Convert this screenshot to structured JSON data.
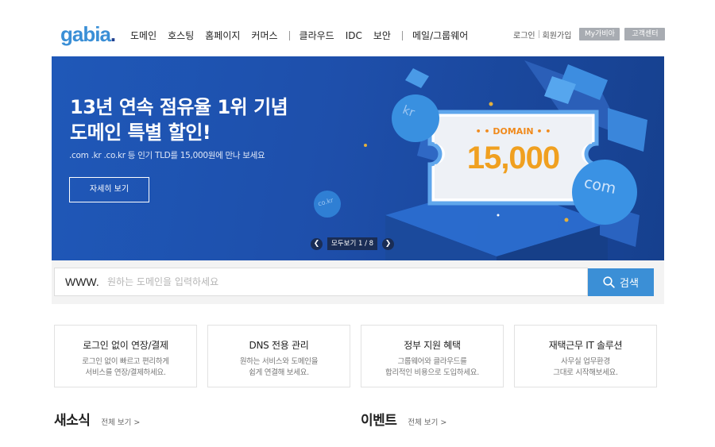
{
  "header": {
    "logo": "gabia",
    "logo_dot": ".",
    "nav_group1": [
      "도메인",
      "호스팅",
      "홈페이지",
      "커머스"
    ],
    "nav_group2": [
      "클라우드",
      "IDC",
      "보안"
    ],
    "nav_group3": [
      "메일/그룹웨어"
    ],
    "login": "로그인",
    "signup": "회원가입",
    "my_gabia": "My가비아",
    "support": "고객센터"
  },
  "banner": {
    "title_line1": "13년 연속 점유율 1위 기념",
    "title_line2": "도메인 특별 할인!",
    "subtitle": ".com .kr .co.kr 등 인기 TLD를 15,000원에 만나 보세요",
    "more_button": "자세히 보기",
    "ticket_label": "DOMAIN",
    "ticket_price": "15,000",
    "bubble_kr": "kr",
    "bubble_com": "com",
    "bubble_cokr": "co.kr",
    "pager_text": "모두보기 1 / 8",
    "colors": {
      "bg": "#1f58b8",
      "price": "#f0a020"
    }
  },
  "search": {
    "prefix": "WWW.",
    "placeholder": "원하는 도메인을 입력하세요",
    "button": "검색"
  },
  "cards": [
    {
      "title": "로그인 없이 연장/결제",
      "desc1": "로그인 없이 빠르고 편리하게",
      "desc2": "서비스를 연장/결제하세요."
    },
    {
      "title": "DNS 전용 관리",
      "desc1": "원하는 서비스와 도메인을",
      "desc2": "쉽게 연결해 보세요."
    },
    {
      "title": "정부 지원 혜택",
      "desc1": "그룹웨어와 클라우드를",
      "desc2": "합리적인 비용으로 도입하세요."
    },
    {
      "title": "재택근무 IT 솔루션",
      "desc1": "사무실 업무환경",
      "desc2": "그대로 시작해보세요."
    }
  ],
  "sections": {
    "news": "새소식",
    "news_all": "전체 보기 >",
    "events": "이벤트",
    "events_all": "전체 보기 >"
  }
}
